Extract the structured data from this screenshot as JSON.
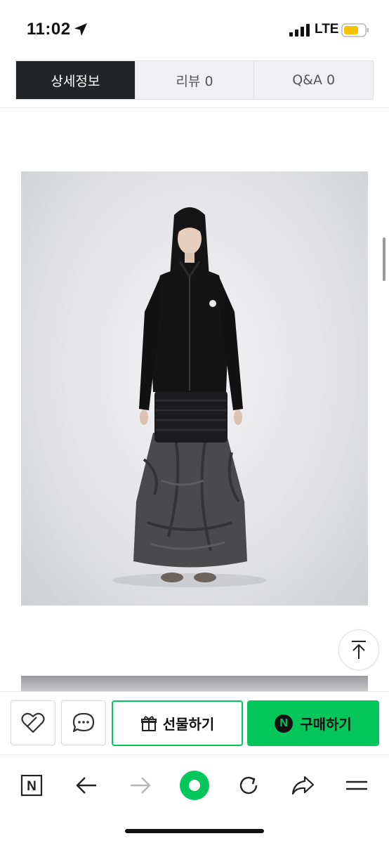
{
  "status_bar": {
    "time": "11:02",
    "network": "LTE",
    "icons": [
      "location-arrow-icon",
      "signal-bars-icon",
      "battery-icon"
    ],
    "battery_color": "#f5c400"
  },
  "tabs": [
    {
      "label": "상세정보",
      "active": true
    },
    {
      "label": "리뷰  0",
      "active": false
    },
    {
      "label": "Q&A  0",
      "active": false
    }
  ],
  "colors": {
    "accent_green": "#03c75a",
    "tab_active_bg": "#222527",
    "tab_inactive_bg": "#f0f0f4"
  },
  "purchase_bar": {
    "wishlist_icon": "heart-icon",
    "chat_icon": "chat-bubble-icon",
    "gift_label": "선물하기",
    "gift_icon": "gift-icon",
    "buy_badge": "N",
    "buy_label": "구매하기"
  },
  "browser_toolbar": {
    "icons": [
      "naver-n-icon",
      "back-arrow-icon",
      "forward-arrow-icon",
      "home-dot-icon",
      "refresh-icon",
      "share-icon",
      "menu-icon"
    ],
    "naver_label": "N"
  }
}
